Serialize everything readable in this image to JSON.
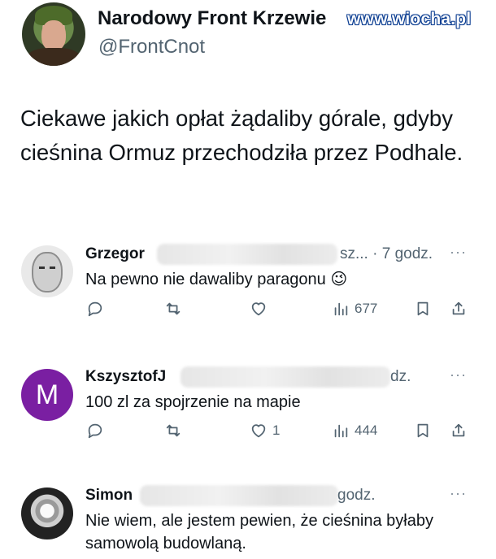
{
  "main_tweet": {
    "author_name": "Narodowy Front Krzewie",
    "handle": "@FrontCnot",
    "text": "Ciekawe jakich opłat żądaliby górale, gdyby cieśnina Ormuz przechodziła przez Podhale."
  },
  "watermark": "www.wiocha.pl",
  "replies": [
    {
      "name": "Grzegor",
      "meta": "sz... · 7 godz.",
      "text": "Na pewno nie dawaliby paragonu 😉",
      "views": "677",
      "likes": ""
    },
    {
      "name": "KszysztofJ",
      "meta": "dz.",
      "avatar_letter": "M",
      "avatar_color": "#7a1fa2",
      "text": "100 zl za spojrzenie na mapie",
      "views": "444",
      "likes": "1"
    },
    {
      "name": "Simon",
      "meta": "godz.",
      "text": "Nie wiem, ale jestem pewien, że cieśnina byłaby samowolą budowlaną."
    }
  ],
  "more_label": "···"
}
